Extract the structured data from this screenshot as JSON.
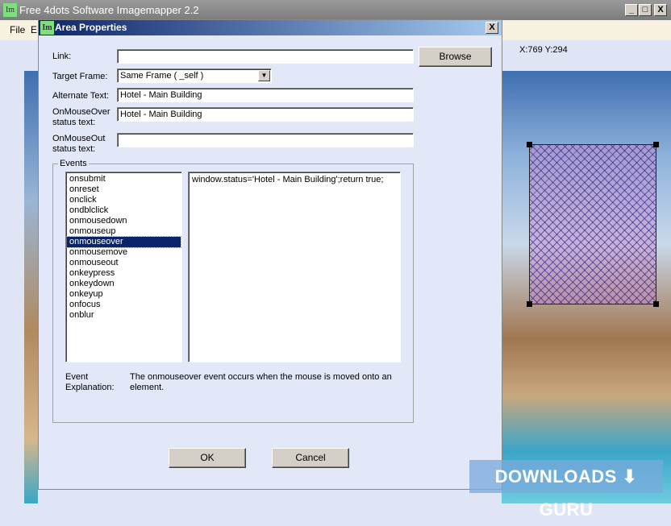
{
  "main_window": {
    "title": "Free 4dots Software Imagemapper 2.2",
    "icon": "Im",
    "controls": [
      "_",
      "□",
      "X"
    ],
    "menu": [
      "File",
      "E"
    ],
    "coords": "X:769 Y:294"
  },
  "dialog": {
    "title": "Area Properties",
    "icon": "Im",
    "close": "X",
    "link_label": "Link:",
    "link_value": "",
    "browse": "Browse",
    "target_label": "Target Frame:",
    "target_value": "Same Frame ( _self )",
    "alt_label": "Alternate Text:",
    "alt_value": "Hotel - Main Building",
    "over_label1": "OnMouseOver",
    "over_label2": "status text:",
    "over_value": "Hotel - Main Building",
    "out_label1": "OnMouseOut",
    "out_label2": "status text:",
    "out_value": "",
    "events_label": "Events",
    "events": [
      "onsubmit",
      "onreset",
      "onclick",
      "ondblclick",
      "onmousedown",
      "onmouseup",
      "onmouseover",
      "onmousemove",
      "onmouseout",
      "onkeypress",
      "onkeydown",
      "onkeyup",
      "onfocus",
      "onblur"
    ],
    "selected_event": "onmouseover",
    "code": "window.status='Hotel - Main Building';return true;",
    "expl_label1": "Event",
    "expl_label2": "Explanation:",
    "explanation": "The onmouseover event occurs when the mouse is moved onto an element.",
    "ok": "OK",
    "cancel": "Cancel"
  },
  "watermark": "DOWNLOADS ⬇ GURU"
}
